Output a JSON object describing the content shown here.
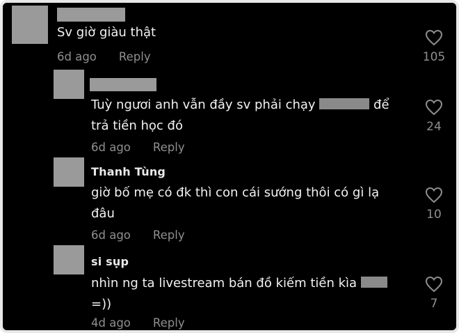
{
  "comments": [
    {
      "name": "",
      "text": "Sv giờ giàu thật",
      "time": "6d ago",
      "reply_label": "Reply",
      "likes": "105",
      "name_redacted": true
    },
    {
      "name": "",
      "text_line1": "Tuỳ ngươi anh vẫn đầy sv phải chạy",
      "text_line1_after": "để",
      "text_line2": "trả tiền học đó",
      "time": "6d ago",
      "reply_label": "Reply",
      "likes": "24",
      "name_redacted": true
    },
    {
      "name": "Thanh Tùng",
      "text_line1": "giờ bố mẹ có đk thì con cái sướng thôi có gì lạ",
      "text_line2": "đâu",
      "time": "6d ago",
      "reply_label": "Reply",
      "likes": "10"
    },
    {
      "name": "si sụp",
      "text_line1": "nhìn ng ta livestream bán đồ kiếm tiền kìa",
      "text_line2": "=))",
      "time": "4d ago",
      "reply_label": "Reply",
      "likes": "7"
    }
  ],
  "icons": {
    "like": "heart-outline-icon",
    "avatar": "avatar-placeholder"
  },
  "colors": {
    "background": "#000000",
    "text": "#f2f2f2",
    "meta": "#8f8f8f",
    "redaction": "#9a9a9a",
    "border": "#e8e8e8"
  }
}
